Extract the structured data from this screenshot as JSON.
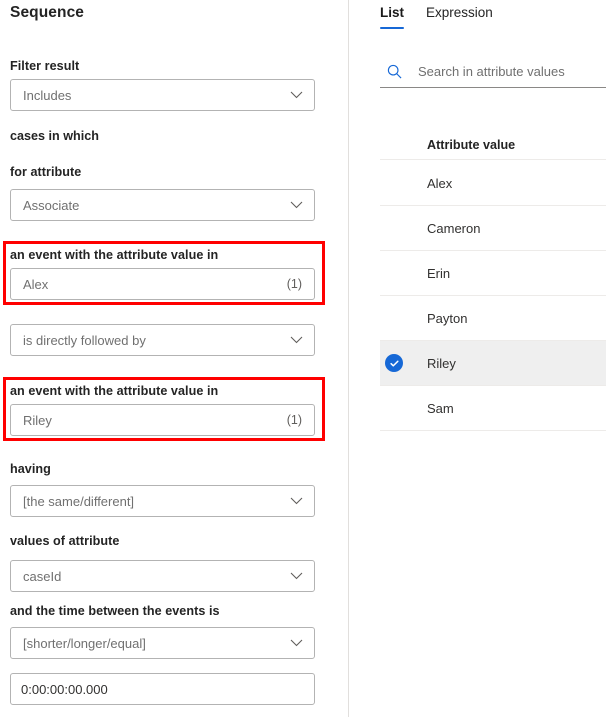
{
  "left": {
    "title": "Sequence",
    "fields": [
      {
        "label": "Filter result",
        "value": "Includes",
        "type": "dropdown"
      },
      {
        "label": "cases in which",
        "type": "text-only"
      },
      {
        "label": "for attribute",
        "value": "Associate",
        "type": "dropdown"
      },
      {
        "label": "an event with the attribute value in",
        "value": "Alex",
        "count": "(1)",
        "type": "value-input",
        "highlighted": true
      },
      {
        "label": "",
        "value": "is directly followed by",
        "type": "dropdown"
      },
      {
        "label": "an event with the attribute value in",
        "value": "Riley",
        "count": "(1)",
        "type": "value-input",
        "highlighted": true
      },
      {
        "label": "having",
        "value": "[the same/different]",
        "type": "dropdown"
      },
      {
        "label": "values of attribute",
        "value": "caseId",
        "type": "dropdown"
      },
      {
        "label": "and the time between the events is",
        "value": "[shorter/longer/equal]",
        "type": "dropdown"
      },
      {
        "label": "",
        "value": "0:00:00:00.000",
        "type": "time-input"
      }
    ]
  },
  "right": {
    "tabs": [
      {
        "label": "List",
        "active": true
      },
      {
        "label": "Expression",
        "active": false
      }
    ],
    "search": {
      "placeholder": "Search in attribute values",
      "value": "",
      "icon": "search-icon"
    },
    "list_header": "Attribute value",
    "items": [
      {
        "label": "Alex",
        "selected": false
      },
      {
        "label": "Cameron",
        "selected": false
      },
      {
        "label": "Erin",
        "selected": false
      },
      {
        "label": "Payton",
        "selected": false
      },
      {
        "label": "Riley",
        "selected": true
      },
      {
        "label": "Sam",
        "selected": false
      }
    ]
  },
  "colors": {
    "accent": "#1668d6",
    "highlight_outline": "#ff0000",
    "selected_row_bg": "#efefef",
    "border": "#b3b3b3",
    "text": "#242424",
    "placeholder": "#707070"
  }
}
